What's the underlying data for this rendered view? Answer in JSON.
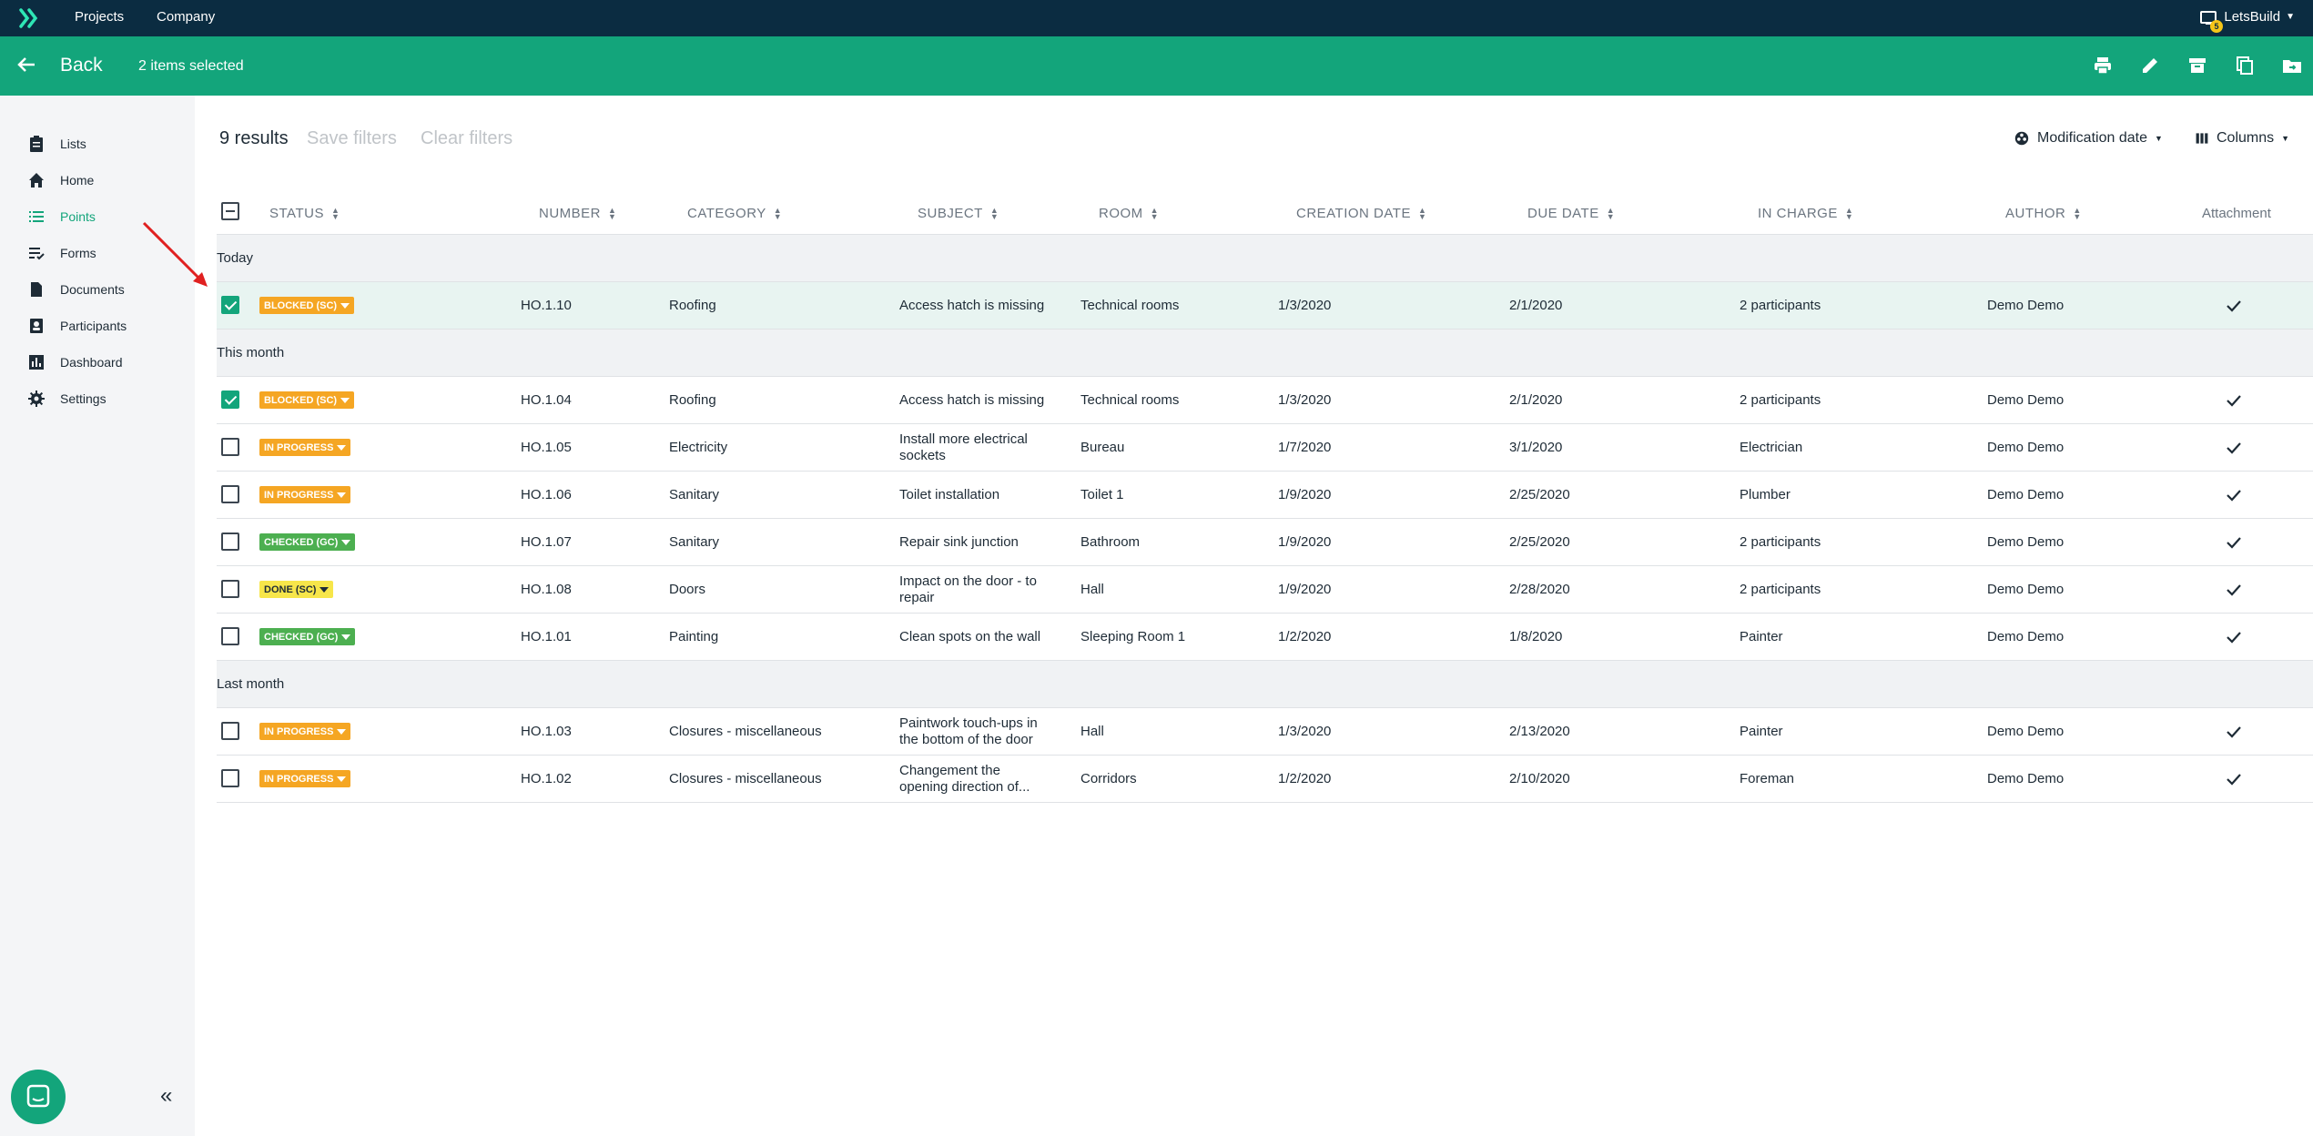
{
  "topnav": {
    "projects": "Projects",
    "company": "Company",
    "user": "LetsBuild",
    "notif_count": "5"
  },
  "actionbar": {
    "back": "Back",
    "selected": "2 items selected"
  },
  "sidebar": {
    "items": [
      {
        "label": "Lists",
        "icon": "clipboard-icon"
      },
      {
        "label": "Home",
        "icon": "home-icon"
      },
      {
        "label": "Points",
        "icon": "list-icon"
      },
      {
        "label": "Forms",
        "icon": "form-icon"
      },
      {
        "label": "Documents",
        "icon": "document-icon"
      },
      {
        "label": "Participants",
        "icon": "participants-icon"
      },
      {
        "label": "Dashboard",
        "icon": "dashboard-icon"
      },
      {
        "label": "Settings",
        "icon": "gear-icon"
      }
    ],
    "collapse": "«"
  },
  "toolbar": {
    "results": "9 results",
    "save_filters": "Save filters",
    "clear_filters": "Clear filters",
    "sort": "Modification date",
    "columns": "Columns"
  },
  "columns": {
    "status": "STATUS",
    "number": "NUMBER",
    "category": "CATEGORY",
    "subject": "SUBJECT",
    "room": "ROOM",
    "creation": "CREATION DATE",
    "due": "DUE DATE",
    "incharge": "IN CHARGE",
    "author": "AUTHOR",
    "attachment": "Attachment"
  },
  "groups": [
    "Today",
    "This month",
    "Last month"
  ],
  "colors": {
    "blocked": "#f5a623",
    "inprogress": "#f5a623",
    "checked": "#4caf50",
    "done": "#f7e64a",
    "accent": "#13a57b"
  },
  "rows": [
    {
      "checked": true,
      "status": "BLOCKED (SC)",
      "number": "HO.1.10",
      "category": "Roofing",
      "subject_1": "Access hatch is missing",
      "subject_2": "",
      "room": "Technical rooms",
      "creation": "1/3/2020",
      "due": "2/1/2020",
      "incharge": "2 participants",
      "author": "Demo Demo"
    },
    {
      "checked": true,
      "status": "BLOCKED (SC)",
      "number": "HO.1.04",
      "category": "Roofing",
      "subject_1": "Access hatch is missing",
      "subject_2": "",
      "room": "Technical rooms",
      "creation": "1/3/2020",
      "due": "2/1/2020",
      "incharge": "2 participants",
      "author": "Demo Demo"
    },
    {
      "checked": false,
      "status": "IN PROGRESS",
      "number": "HO.1.05",
      "category": "Electricity",
      "subject_1": "Install more electrical",
      "subject_2": "sockets",
      "room": "Bureau",
      "creation": "1/7/2020",
      "due": "3/1/2020",
      "incharge": "Electrician",
      "author": "Demo Demo"
    },
    {
      "checked": false,
      "status": "IN PROGRESS",
      "number": "HO.1.06",
      "category": "Sanitary",
      "subject_1": "Toilet installation",
      "subject_2": "",
      "room": "Toilet 1",
      "creation": "1/9/2020",
      "due": "2/25/2020",
      "incharge": "Plumber",
      "author": "Demo Demo"
    },
    {
      "checked": false,
      "status": "CHECKED (GC)",
      "number": "HO.1.07",
      "category": "Sanitary",
      "subject_1": "Repair sink junction",
      "subject_2": "",
      "room": "Bathroom",
      "creation": "1/9/2020",
      "due": "2/25/2020",
      "incharge": "2 participants",
      "author": "Demo Demo"
    },
    {
      "checked": false,
      "status": "DONE (SC)",
      "number": "HO.1.08",
      "category": "Doors",
      "subject_1": "Impact on the door - to",
      "subject_2": "repair",
      "room": "Hall",
      "creation": "1/9/2020",
      "due": "2/28/2020",
      "incharge": "2 participants",
      "author": "Demo Demo"
    },
    {
      "checked": false,
      "status": "CHECKED (GC)",
      "number": "HO.1.01",
      "category": "Painting",
      "subject_1": "Clean spots on the wall",
      "subject_2": "",
      "room": "Sleeping Room 1",
      "creation": "1/2/2020",
      "due": "1/8/2020",
      "incharge": "Painter",
      "author": "Demo Demo"
    },
    {
      "checked": false,
      "status": "IN PROGRESS",
      "number": "HO.1.03",
      "category": "Closures - miscellaneous",
      "subject_1": "Paintwork touch-ups in",
      "subject_2": "the bottom of the door",
      "room": "Hall",
      "creation": "1/3/2020",
      "due": "2/13/2020",
      "incharge": "Painter",
      "author": "Demo Demo"
    },
    {
      "checked": false,
      "status": "IN PROGRESS",
      "number": "HO.1.02",
      "category": "Closures - miscellaneous",
      "subject_1": "Changement the",
      "subject_2": "opening direction of...",
      "room": "Corridors",
      "creation": "1/2/2020",
      "due": "2/10/2020",
      "incharge": "Foreman",
      "author": "Demo Demo"
    }
  ]
}
